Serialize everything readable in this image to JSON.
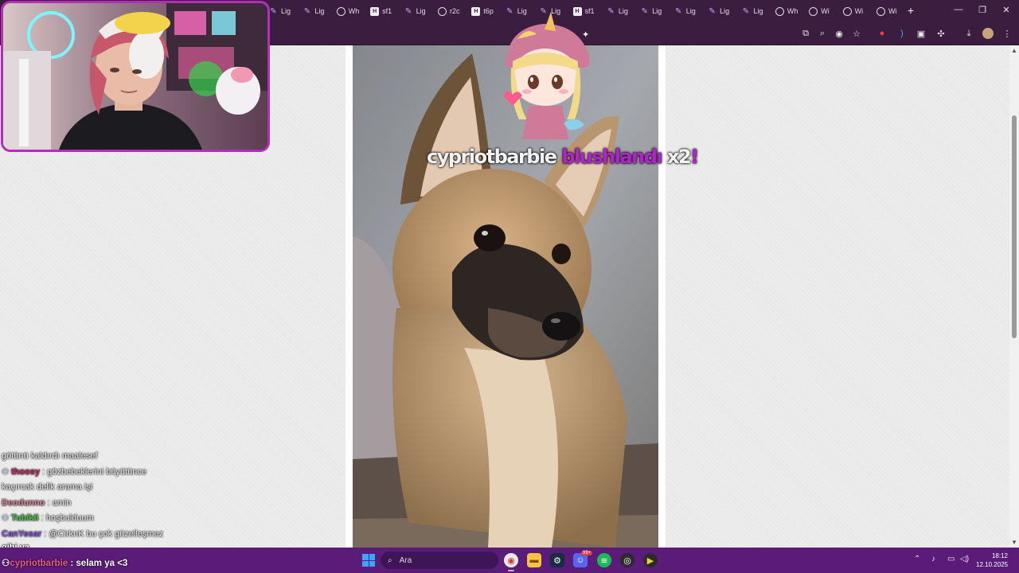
{
  "browser": {
    "tabs": [
      {
        "icon": "pen",
        "label": "Lig"
      },
      {
        "icon": "pen",
        "label": "Lig"
      },
      {
        "icon": "globe",
        "label": "Wh"
      },
      {
        "icon": "hbox",
        "label": "sf1"
      },
      {
        "icon": "pen",
        "label": "Lig"
      },
      {
        "icon": "globe",
        "label": "r2c"
      },
      {
        "icon": "hbox",
        "label": "t6p"
      },
      {
        "icon": "pen",
        "label": "Lig"
      },
      {
        "icon": "pen",
        "label": "Lig"
      },
      {
        "icon": "hbox",
        "label": "sf1"
      },
      {
        "icon": "pen",
        "label": "Lig"
      },
      {
        "icon": "pen",
        "label": "Lig"
      },
      {
        "icon": "pen",
        "label": "Lig"
      },
      {
        "icon": "pen",
        "label": "Lig"
      },
      {
        "icon": "pen",
        "label": "Lig"
      },
      {
        "icon": "globe",
        "label": "Wh"
      },
      {
        "icon": "globe",
        "label": "Wi"
      },
      {
        "icon": "globe",
        "label": "Wi"
      },
      {
        "icon": "globe",
        "label": "Wi"
      }
    ],
    "new_tab": "+",
    "minimize": "—",
    "maximize": "❐",
    "close": "✕",
    "accent": "#3b1e3f"
  },
  "alert": {
    "username": "cypriotbarbie",
    "action": "blushlandı",
    "multiplier": "x2",
    "exclaim": "!",
    "highlight_color": "#b222cf"
  },
  "chat": {
    "messages": [
      {
        "user": "",
        "text": "götünü kaldırdı maalesef",
        "color": "#ffffff"
      },
      {
        "user": "thoosy",
        "text": ": gözbebeklerini büyütünce",
        "color": "#c8285c",
        "badge": true
      },
      {
        "user": "",
        "text": "kaçırcak delik arama işi",
        "color": "#ffffff"
      },
      {
        "user": "Deodunno",
        "text": ": amin",
        "color": "#d9849a"
      },
      {
        "user": "Tubikii",
        "text": ": hoşbulduum",
        "color": "#53c04a",
        "badge": true
      },
      {
        "user": "CanYesar",
        "text": ": @CirknK bu çok güzelleşmez",
        "color": "#8e5ad8"
      },
      {
        "user": "",
        "text": "gibi ya",
        "color": "#ffffff"
      }
    ],
    "last": {
      "user": "cypriotbarbie",
      "text": ": selam ya <3"
    }
  },
  "taskbar": {
    "search_placeholder": "Ara",
    "time": "18:12",
    "date": "12.10.2025",
    "discord_badge": "99+"
  }
}
